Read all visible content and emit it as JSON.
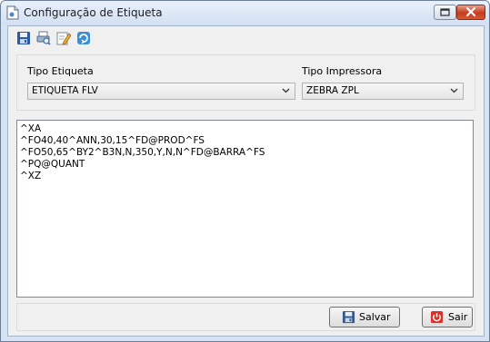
{
  "window": {
    "title": "Configuração de Etiqueta"
  },
  "toolbar": {
    "icons": [
      "save-icon",
      "print-preview-icon",
      "edit-icon",
      "refresh-icon"
    ]
  },
  "form": {
    "tipo_etiqueta_label": "Tipo Etiqueta",
    "tipo_etiqueta_value": "ETIQUETA FLV",
    "tipo_impressora_label": "Tipo Impressora",
    "tipo_impressora_value": "ZEBRA ZPL"
  },
  "editor": {
    "lines": [
      "^XA",
      "^FO40,40^ANN,30,15^FD@PROD^FS",
      "^FO50,65^BY2^B3N,N,350,Y,N,N^FD@BARRA^FS",
      "^PQ@QUANT",
      "^XZ"
    ]
  },
  "buttons": {
    "salvar_label": "Salvar",
    "sair_label": "Sair"
  },
  "colors": {
    "title_bar": "#d2e0f2",
    "close_button": "#c73b1b",
    "panel": "#f0f0f0"
  }
}
